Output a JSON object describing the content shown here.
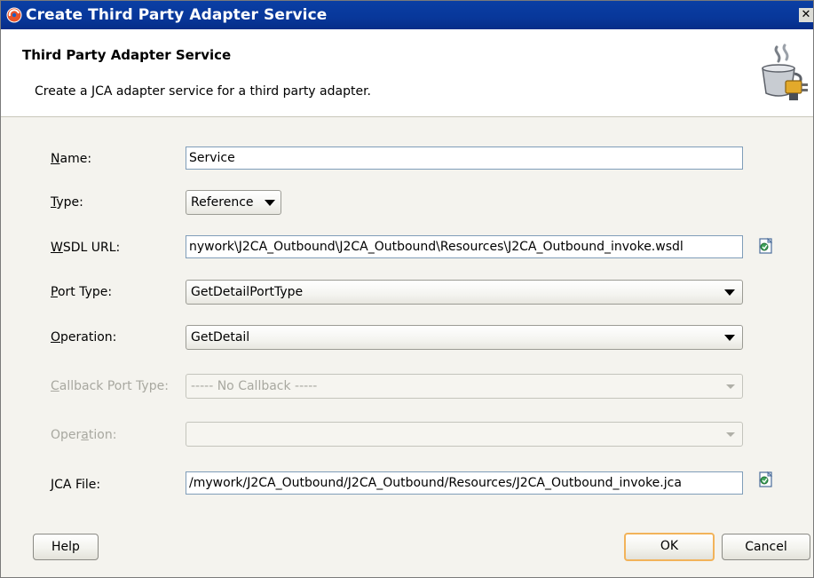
{
  "window": {
    "title": "Create Third Party Adapter Service",
    "close_glyph": "✕"
  },
  "header": {
    "heading": "Third Party Adapter Service",
    "description": "Create a JCA adapter service for a third party adapter."
  },
  "form": {
    "name": {
      "label": "Name:",
      "mnemonic": "N",
      "value": "Service"
    },
    "type": {
      "label": "Type:",
      "mnemonic": "T",
      "value": "Reference"
    },
    "wsdl_url": {
      "label": "WSDL URL:",
      "mnemonic": "W",
      "value": "nywork\\J2CA_Outbound\\J2CA_Outbound\\Resources\\J2CA_Outbound_invoke.wsdl"
    },
    "port_type": {
      "label": "Port Type:",
      "mnemonic": "P",
      "value": "GetDetailPortType"
    },
    "operation": {
      "label": "Operation:",
      "mnemonic": "O",
      "value": "GetDetail"
    },
    "callback_port_type": {
      "label": "Callback Port Type:",
      "mnemonic": "C",
      "value": "----- No Callback -----",
      "enabled": false
    },
    "callback_operation": {
      "label": "Operation:",
      "mnemonic": "a",
      "value": "",
      "enabled": false
    },
    "jca_file": {
      "label": "JCA File:",
      "mnemonic": "J",
      "value": "/mywork/J2CA_Outbound/J2CA_Outbound/Resources/J2CA_Outbound_invoke.jca"
    }
  },
  "buttons": {
    "help": "Help",
    "ok": "OK",
    "cancel": "Cancel"
  },
  "icons": {
    "app": "oracle-jdeveloper-icon",
    "wizard": "adapter-wizard-icon",
    "browse": "browse-icon"
  },
  "colors": {
    "titlebar": "#0a3fa4",
    "default_button_border": "#f2b35a",
    "field_border": "#7f9db9"
  }
}
